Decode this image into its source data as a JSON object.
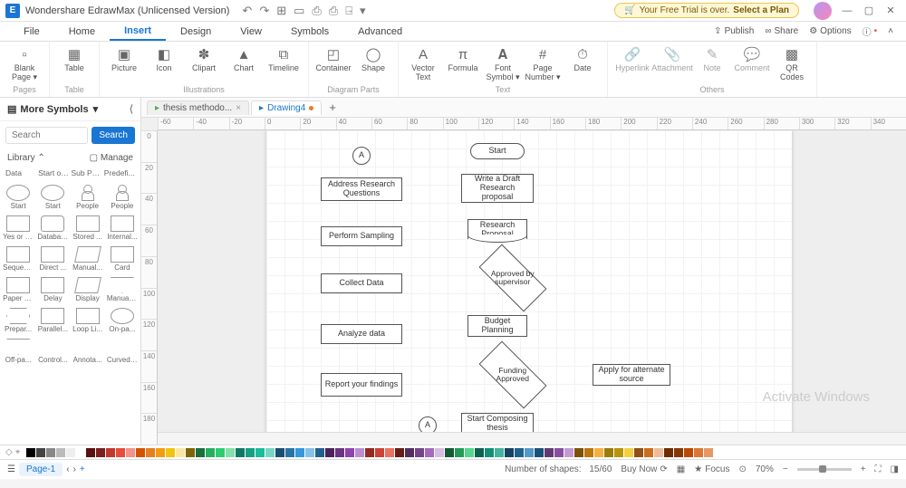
{
  "title": "Wondershare EdrawMax (Unlicensed Version)",
  "trial": {
    "prefix": "Your Free Trial is over.",
    "action": "Select a Plan"
  },
  "menus": [
    "File",
    "Home",
    "Insert",
    "Design",
    "View",
    "Symbols",
    "Advanced"
  ],
  "active_menu": "Insert",
  "top_right": {
    "publish": "Publish",
    "share": "Share",
    "options": "Options"
  },
  "ribbon": {
    "groups": [
      {
        "name": "Pages",
        "items": [
          {
            "icon": "▫",
            "label": "Blank\nPage ▾"
          }
        ]
      },
      {
        "name": "Table",
        "items": [
          {
            "icon": "▦",
            "label": "Table"
          }
        ]
      },
      {
        "name": "Illustrations",
        "items": [
          {
            "icon": "▣",
            "label": "Picture"
          },
          {
            "icon": "◧",
            "label": "Icon"
          },
          {
            "icon": "✽",
            "label": "Clipart"
          },
          {
            "icon": "▲",
            "label": "Chart"
          },
          {
            "icon": "⧉",
            "label": "Timeline"
          }
        ]
      },
      {
        "name": "Diagram Parts",
        "items": [
          {
            "icon": "◰",
            "label": "Container"
          },
          {
            "icon": "◯",
            "label": "Shape"
          }
        ]
      },
      {
        "name": "Text",
        "items": [
          {
            "icon": "A",
            "label": "Vector\nText"
          },
          {
            "icon": "π",
            "label": "Formula"
          },
          {
            "icon": "𝐀",
            "label": "Font\nSymbol ▾"
          },
          {
            "icon": "#",
            "label": "Page\nNumber ▾"
          },
          {
            "icon": "⏱",
            "label": "Date"
          }
        ]
      },
      {
        "name": "Others",
        "items": [
          {
            "icon": "🔗",
            "label": "Hyperlink",
            "disabled": true
          },
          {
            "icon": "📎",
            "label": "Attachment",
            "disabled": true
          },
          {
            "icon": "✎",
            "label": "Note",
            "disabled": true
          },
          {
            "icon": "💬",
            "label": "Comment",
            "disabled": true
          },
          {
            "icon": "▩",
            "label": "QR\nCodes"
          }
        ]
      }
    ]
  },
  "sidebar": {
    "title": "More Symbols",
    "search_placeholder": "Search",
    "search_btn": "Search",
    "library": "Library",
    "manage": "Manage",
    "cats": [
      "Data",
      "Start or...",
      "Sub Pro...",
      "Predefi..."
    ],
    "shapes": [
      {
        "cls": "ellipse",
        "lbl": "Start"
      },
      {
        "cls": "ellipse",
        "lbl": "Start"
      },
      {
        "cls": "person",
        "lbl": "People"
      },
      {
        "cls": "person",
        "lbl": "People"
      },
      {
        "cls": "pill",
        "lbl": "Yes or No"
      },
      {
        "cls": "db",
        "lbl": "Database"
      },
      {
        "cls": "",
        "lbl": "Stored ..."
      },
      {
        "cls": "",
        "lbl": "Internal..."
      },
      {
        "cls": "",
        "lbl": "Sequen..."
      },
      {
        "cls": "",
        "lbl": "Direct ..."
      },
      {
        "cls": "para",
        "lbl": "Manual..."
      },
      {
        "cls": "",
        "lbl": "Card"
      },
      {
        "cls": "",
        "lbl": "Paper T..."
      },
      {
        "cls": "",
        "lbl": "Delay"
      },
      {
        "cls": "para",
        "lbl": "Display"
      },
      {
        "cls": "tri",
        "lbl": "Manual ..."
      },
      {
        "cls": "hex",
        "lbl": "Prepar..."
      },
      {
        "cls": "",
        "lbl": "Parallel..."
      },
      {
        "cls": "",
        "lbl": "Loop Li..."
      },
      {
        "cls": "ellipse",
        "lbl": "On-pa..."
      },
      {
        "cls": "tri",
        "lbl": "Off-pa..."
      },
      {
        "cls": "none",
        "lbl": "Control..."
      },
      {
        "cls": "none",
        "lbl": "Annota..."
      },
      {
        "cls": "none",
        "lbl": "Curved ..."
      }
    ]
  },
  "tabs": [
    {
      "label": "thesis methodo...",
      "active": false
    },
    {
      "label": "Drawing4",
      "active": true,
      "dirty": true
    }
  ],
  "ruler_h": [
    "-60",
    "-40",
    "-20",
    "0",
    "20",
    "40",
    "60",
    "80",
    "100",
    "120",
    "140",
    "160",
    "180",
    "200",
    "220",
    "240",
    "260",
    "280",
    "300",
    "320",
    "340"
  ],
  "ruler_v": [
    "0",
    "20",
    "40",
    "60",
    "80",
    "100",
    "120",
    "140",
    "160",
    "180"
  ],
  "flow": {
    "a1": "A",
    "a2": "A",
    "n1": "Address Research Questions",
    "n2": "Perform Sampling",
    "n3": "Collect Data",
    "n4": "Analyze data",
    "n5": "Report your findings",
    "s1": "Start",
    "s2": "Write a Draft Research proposal",
    "s3": "Research Proposal",
    "s4": "Approved by supervisor",
    "s5": "Budget Planning",
    "s6": "Funding Approved",
    "s7": "Start Composing thesis",
    "alt": "Apply for alternate source"
  },
  "colors": [
    "#000",
    "#444",
    "#888",
    "#bbb",
    "#eee",
    "#fff",
    "#5b0f0f",
    "#7b1e1e",
    "#c0392b",
    "#e74c3c",
    "#f1948a",
    "#d35400",
    "#e67e22",
    "#f39c12",
    "#f1c40f",
    "#f9e79f",
    "#7d6608",
    "#196f3d",
    "#27ae60",
    "#2ecc71",
    "#82e0aa",
    "#117864",
    "#16a085",
    "#1abc9c",
    "#76d7c4",
    "#1b4f72",
    "#2874a6",
    "#3498db",
    "#85c1e9",
    "#21618c",
    "#4a235a",
    "#6c3483",
    "#8e44ad",
    "#bb8fce",
    "#922b21",
    "#cb4335",
    "#ec7063",
    "#641e16",
    "#512e5f",
    "#76448a",
    "#a569bd",
    "#d7bde2",
    "#145a32",
    "#239b56",
    "#58d68d",
    "#0e6251",
    "#148f77",
    "#45b39d",
    "#154360",
    "#1f618d",
    "#5499c7",
    "#1a5276",
    "#633974",
    "#884ea0",
    "#c39bd3",
    "#7e5109",
    "#b9770e",
    "#f5b041",
    "#9a7d0a",
    "#b7950b",
    "#f4d03f",
    "#935116",
    "#ca6f1e",
    "#edbb99",
    "#6e2c00",
    "#873600",
    "#ba4a00",
    "#dc7633",
    "#e59866"
  ],
  "status": {
    "page": "Page-1",
    "shapes_label": "Number of shapes:",
    "shapes": "15/60",
    "buy": "Buy Now",
    "focus": "Focus",
    "zoom": "70%"
  },
  "watermark": "Activate Windows"
}
